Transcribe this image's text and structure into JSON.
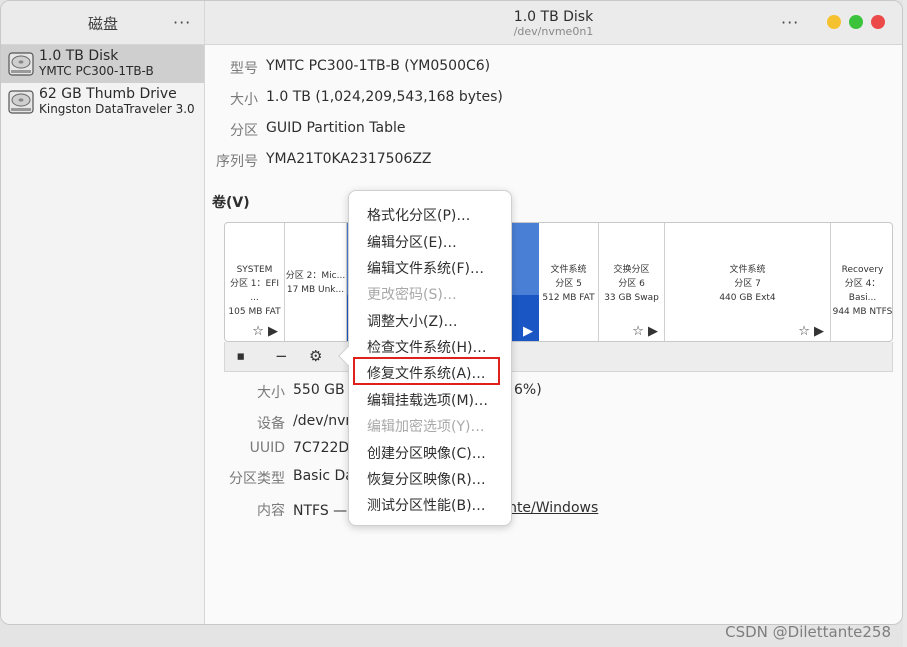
{
  "sidebar_header": {
    "title": "磁盘",
    "menu": "···"
  },
  "header": {
    "title": "1.0 TB Disk",
    "subtitle": "/dev/nvme0n1",
    "menu": "···"
  },
  "window_buttons": {
    "minimize_color": "#f5c12e",
    "maximize_color": "#3bc43b",
    "close_color": "#ec4a48"
  },
  "drives": [
    {
      "name": "1.0 TB Disk",
      "model": "YMTC PC300-1TB-B",
      "icon": "hard-disk-icon"
    },
    {
      "name": "62 GB Thumb Drive",
      "model": "Kingston DataTraveler 3.0",
      "icon": "hard-disk-icon"
    }
  ],
  "disk_props": [
    {
      "key": "型号",
      "value": "YMTC PC300-1TB-B (YM0500C6)"
    },
    {
      "key": "大小",
      "value": "1.0 TB (1,024,209,543,168 bytes)"
    },
    {
      "key": "分区",
      "value": "GUID Partition Table"
    },
    {
      "key": "序列号",
      "value": "YMA21T0KA2317506ZZ"
    }
  ],
  "volumes_title": "卷(V)",
  "segments": [
    {
      "l1": "SYSTEM",
      "l2": "分区 1：EFI ...",
      "l3": "105 MB FAT"
    },
    {
      "l1": "",
      "l2": "分区 2：Mic...",
      "l3": "17 MB Unk..."
    },
    {
      "l1": "文件系统",
      "l2": "分区 5",
      "l3": "512 MB FAT"
    },
    {
      "l1": "交换分区",
      "l2": "分区 6",
      "l3": "33 GB Swap"
    },
    {
      "l1": "文件系统",
      "l2": "分区 7",
      "l3": "440 GB Ext4"
    },
    {
      "l1": "Recovery",
      "l2": "分区 4：Basi...",
      "l3": "944 MB NTFS"
    }
  ],
  "toolbar": {
    "stop": "⏹",
    "minus": "−",
    "gear": "⚙"
  },
  "partition_props": [
    {
      "key": "大小",
      "value": "550 GB —",
      "tail": "6%)"
    },
    {
      "key": "设备",
      "value": "/dev/nvme"
    },
    {
      "key": "UUID",
      "value": "7C722D0"
    },
    {
      "key": "分区类型",
      "value": "Basic Dat"
    },
    {
      "key": "内容",
      "value": "NTFS — 已",
      "link": "tante/Windows"
    }
  ],
  "menu_items": [
    {
      "label": "格式化分区(P)…",
      "disabled": false
    },
    {
      "label": "编辑分区(E)…",
      "disabled": false
    },
    {
      "label": "编辑文件系统(F)…",
      "disabled": false
    },
    {
      "label": "更改密码(S)…",
      "disabled": true
    },
    {
      "label": "调整大小(Z)…",
      "disabled": false
    },
    {
      "label": "检查文件系统(H)…",
      "disabled": false
    },
    {
      "label": "修复文件系统(A)…",
      "disabled": false
    },
    {
      "label": "编辑挂载选项(M)…",
      "disabled": false
    },
    {
      "label": "编辑加密选项(Y)…",
      "disabled": true
    },
    {
      "label": "创建分区映像(C)…",
      "disabled": false
    },
    {
      "label": "恢复分区映像(R)…",
      "disabled": false
    },
    {
      "label": "测试分区性能(B)…",
      "disabled": false
    }
  ],
  "colors": {
    "selected_partition": "#4a7fd6",
    "selected_partition_dark": "#1a57c4",
    "highlight_box": "#e0201c"
  },
  "watermark": "CSDN @Dilettante258"
}
